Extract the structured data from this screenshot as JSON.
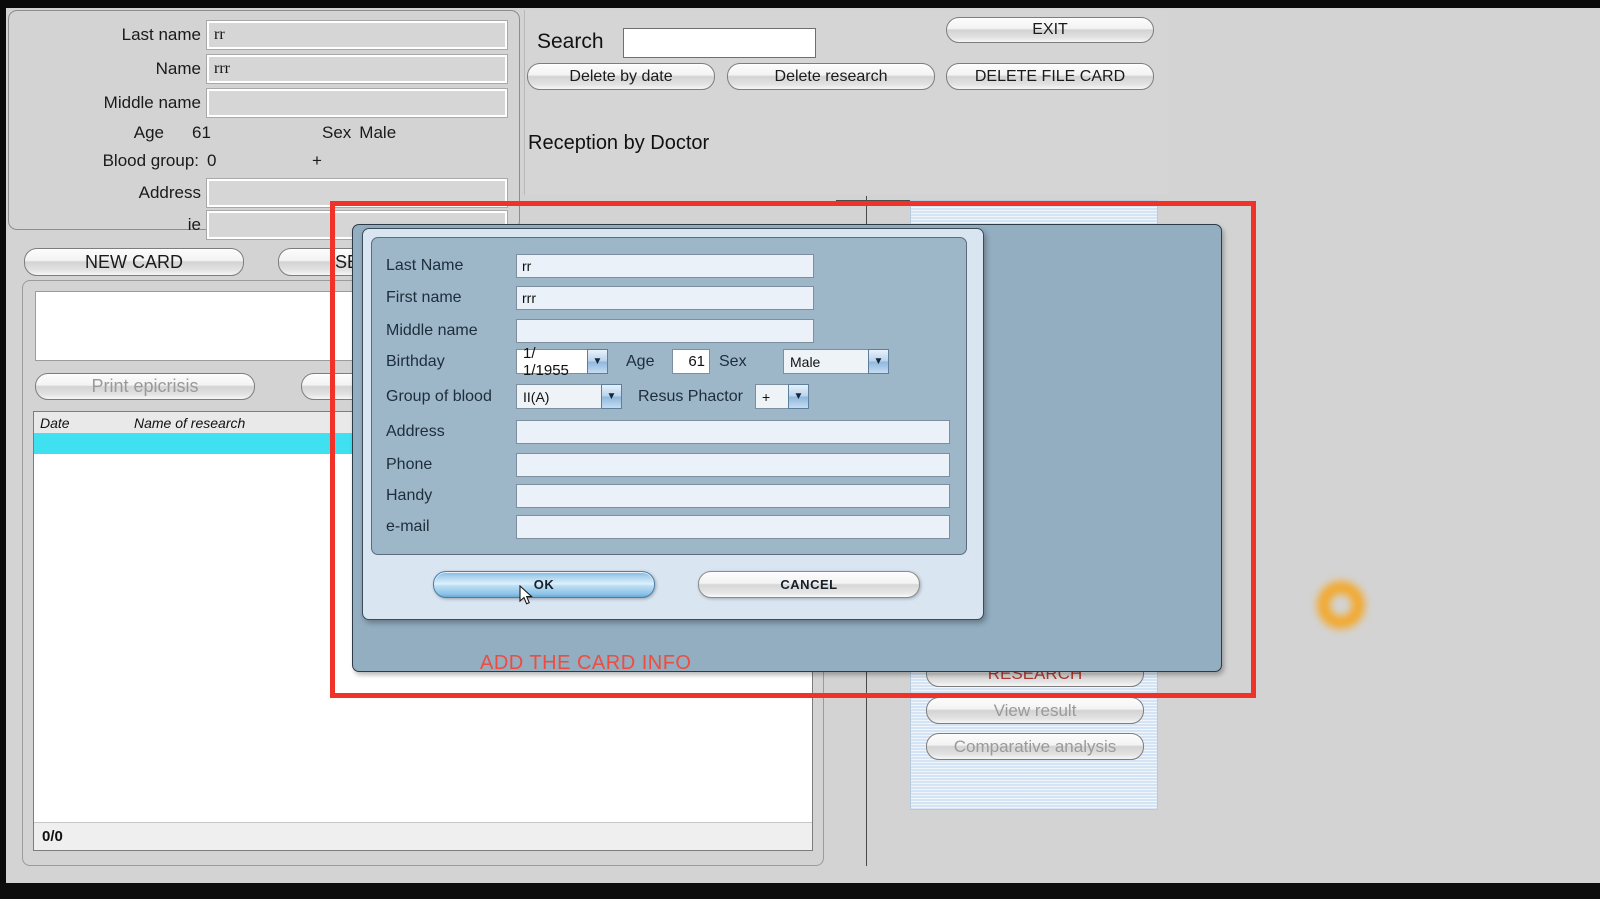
{
  "app": {
    "background_color": "#d3d3d3"
  },
  "patient_panel": {
    "fields": [
      {
        "label": "Last name",
        "value": "rr"
      },
      {
        "label": "Name",
        "value": "rrr"
      },
      {
        "label": "Middle name",
        "value": ""
      }
    ],
    "age_label": "Age",
    "age_value": "61",
    "sex_label": "Sex",
    "sex_value": "Male",
    "blood_group_label": "Blood group:",
    "blood_group_value": "0",
    "resus_value": "+",
    "address_label": "Address",
    "address_value": "",
    "ie_label": "ie",
    "ie_value": ""
  },
  "search_panel": {
    "search_label": "Search",
    "search_value": "",
    "search_placeholder": "",
    "exit_button": "EXIT",
    "delete_by_date_button": "Delete by date",
    "delete_research_button": "Delete research",
    "delete_file_card_button": "DELETE FILE CARD",
    "reception_label": "Reception by Doctor"
  },
  "left_lower": {
    "new_card_button": "NEW CARD",
    "search_card_button": "SE",
    "print_epicrisis_button": "Print epicrisis",
    "grid": {
      "columns": [
        "Date",
        "Name of research"
      ],
      "rows": [],
      "status": "0/0"
    }
  },
  "right_panel": {
    "research_button": "RESEARCH",
    "view_result_button": "View result",
    "comparative_analysis_button": "Comparative analysis"
  },
  "modal": {
    "fields": [
      {
        "label": "Last Name",
        "value": "rr"
      },
      {
        "label": "First name",
        "value": "rrr"
      },
      {
        "label": "Middle name",
        "value": ""
      }
    ],
    "birthday_label": "Birthday",
    "birthday_value": "1/  1/1955",
    "age_label": "Age",
    "age_value": "61",
    "sex_label": "Sex",
    "sex_value": "Male",
    "blood_label": "Group of blood",
    "blood_value": "II(A)",
    "resus_label": "Resus Phactor",
    "resus_value": "+",
    "address_label": "Address",
    "address_value": "",
    "phone_label": "Phone",
    "phone_value": "",
    "handy_label": "Handy",
    "handy_value": "",
    "email_label": "e-mail",
    "email_value": "",
    "ok_button": "OK",
    "cancel_button": "CANCEL",
    "dropdown_arrow": "▼"
  },
  "annotation": {
    "caption": "ADD THE CARD INFO",
    "box_color": "#f03228",
    "caption_color": "#ef4b3f",
    "click_marker_color": "#f5a623"
  }
}
